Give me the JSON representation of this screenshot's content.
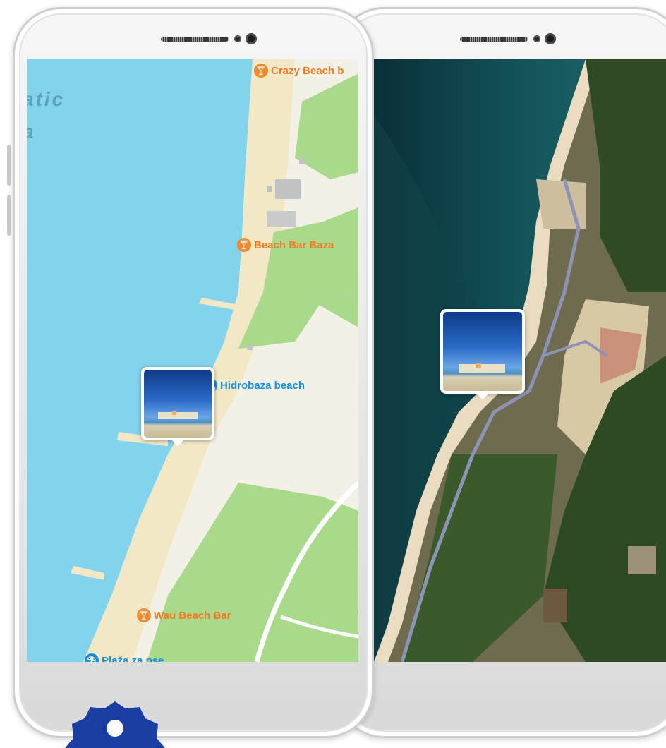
{
  "left_phone": {
    "sea_label": "atic\na",
    "map_pois": [
      {
        "name": "Crazy Beach b",
        "type": "bar",
        "icon": "cocktail-icon"
      },
      {
        "name": "Beach Bar Baza",
        "type": "bar",
        "icon": "cocktail-icon"
      },
      {
        "name": "Hidrobaza beach",
        "type": "beach",
        "icon": "beach-icon"
      },
      {
        "name": "Wau Beach Bar",
        "type": "bar",
        "icon": "cocktail-icon"
      },
      {
        "name": "Plaža za pse",
        "type": "beach",
        "icon": "beach-icon"
      }
    ]
  },
  "colors": {
    "sea": "#84d3ec",
    "sand": "#f3e8c6",
    "grass": "#a9d98a",
    "land": "#f3f0e6",
    "bar_poi": "#f07b22",
    "beach_poi": "#1c8fd8",
    "badge": "#1b3ea5"
  }
}
